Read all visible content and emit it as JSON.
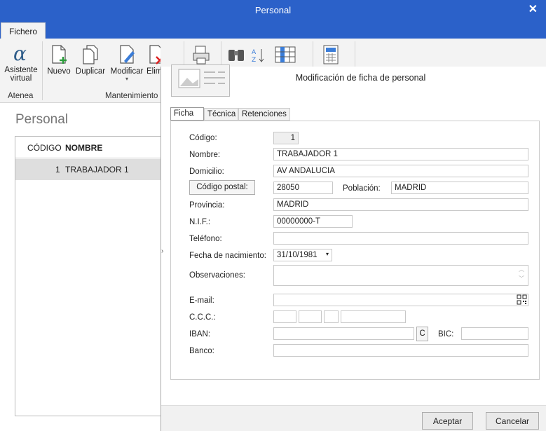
{
  "window": {
    "title": "Personal",
    "close_glyph": "✕"
  },
  "ribbon": {
    "tab": "Fichero",
    "buttons": {
      "asistente_line1": "Asistente",
      "asistente_line2": "virtual",
      "nuevo": "Nuevo",
      "duplicar": "Duplicar",
      "modificar": "Modificar",
      "eliminar": "Elim"
    },
    "groups": {
      "atenea": "Atenea",
      "mantenimiento": "Mantenimiento"
    }
  },
  "main": {
    "title": "Personal",
    "grid": {
      "columns": [
        "CÓDIGO",
        "NOMBRE"
      ],
      "rows": [
        {
          "codigo": "1",
          "nombre": "TRABAJADOR 1"
        }
      ]
    }
  },
  "dialog": {
    "title": "Modificación de ficha de personal",
    "tabs": [
      "Ficha",
      "Técnica",
      "Retenciones"
    ],
    "labels": {
      "codigo": "Código:",
      "nombre": "Nombre:",
      "domicilio": "Domicilio:",
      "codigo_postal": "Código postal:",
      "poblacion": "Población:",
      "provincia": "Provincia:",
      "nif": "N.I.F.:",
      "telefono": "Teléfono:",
      "fecha_nacimiento": "Fecha de nacimiento:",
      "observaciones": "Observaciones:",
      "email": "E-mail:",
      "ccc": "C.C.C.:",
      "iban": "IBAN:",
      "bic": "BIC:",
      "banco": "Banco:"
    },
    "values": {
      "codigo": "1",
      "nombre": "TRABAJADOR 1",
      "domicilio": "AV ANDALUCIA",
      "codigo_postal": "28050",
      "poblacion": "MADRID",
      "provincia": "MADRID",
      "nif": "00000000-T",
      "telefono": "",
      "fecha_nacimiento": "31/10/1981",
      "observaciones": "",
      "email": "",
      "iban": "",
      "bic": "",
      "banco": ""
    },
    "iban_button": "C",
    "buttons": {
      "accept": "Aceptar",
      "cancel": "Cancelar"
    }
  }
}
